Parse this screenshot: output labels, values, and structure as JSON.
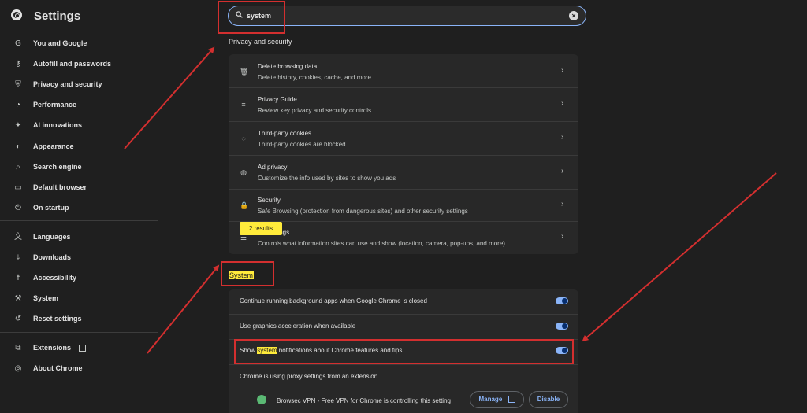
{
  "app": {
    "title": "Settings"
  },
  "search": {
    "value": "system",
    "clear_icon": "close-icon"
  },
  "sidebar": {
    "items": [
      {
        "label": "You and Google",
        "icon": "google-icon"
      },
      {
        "label": "Autofill and passwords",
        "icon": "key-icon"
      },
      {
        "label": "Privacy and security",
        "icon": "shield-icon"
      },
      {
        "label": "Performance",
        "icon": "speedometer-icon"
      },
      {
        "label": "AI innovations",
        "icon": "sparkle-icon"
      },
      {
        "label": "Appearance",
        "icon": "palette-icon"
      },
      {
        "label": "Search engine",
        "icon": "search-icon"
      },
      {
        "label": "Default browser",
        "icon": "browser-icon"
      },
      {
        "label": "On startup",
        "icon": "power-icon"
      },
      {
        "label": "Languages",
        "icon": "translate-icon"
      },
      {
        "label": "Downloads",
        "icon": "download-icon"
      },
      {
        "label": "Accessibility",
        "icon": "accessibility-icon"
      },
      {
        "label": "System",
        "icon": "wrench-icon"
      },
      {
        "label": "Reset settings",
        "icon": "reset-icon"
      },
      {
        "label": "Extensions",
        "icon": "puzzle-icon"
      },
      {
        "label": "About Chrome",
        "icon": "chrome-icon"
      }
    ]
  },
  "privacy": {
    "title": "Privacy and security",
    "rows": [
      {
        "title": "Delete browsing data",
        "sub": "Delete history, cookies, cache, and more",
        "icon": "trash-icon"
      },
      {
        "title": "Privacy Guide",
        "sub": "Review key privacy and security controls",
        "icon": "guide-icon"
      },
      {
        "title": "Third-party cookies",
        "sub": "Third-party cookies are blocked",
        "icon": "cookie-icon"
      },
      {
        "title": "Ad privacy",
        "sub": "Customize the info used by sites to show you ads",
        "icon": "ad-privacy-icon"
      },
      {
        "title": "Security",
        "sub": "Safe Browsing (protection from dangerous sites) and other security settings",
        "icon": "lock-icon"
      },
      {
        "title": "Site Settings",
        "title_visible": "ttings",
        "sub": "Controls what information sites can use and show (location, camera, pop-ups, and more)",
        "icon": "sliders-icon"
      }
    ],
    "results_badge": "2 results"
  },
  "system": {
    "title": "System",
    "rows": [
      {
        "label": "Continue running background apps when Google Chrome is closed",
        "on": true
      },
      {
        "label": "Use graphics acceleration when available",
        "on": true
      },
      {
        "label_pre": "Show ",
        "label_hl": "system",
        "label_post": " notifications about Chrome features and tips",
        "on": true
      }
    ],
    "proxy_note": "Chrome is using proxy settings from an extension",
    "extension_text": "Browsec VPN - Free VPN for Chrome is controlling this setting",
    "manage_label": "Manage",
    "disable_label": "Disable"
  },
  "colors": {
    "accent": "#8ab4f8",
    "highlight": "#ffeb3b",
    "annotation": "#d32f2f",
    "background": "#1f1f1f",
    "card": "#282828"
  }
}
